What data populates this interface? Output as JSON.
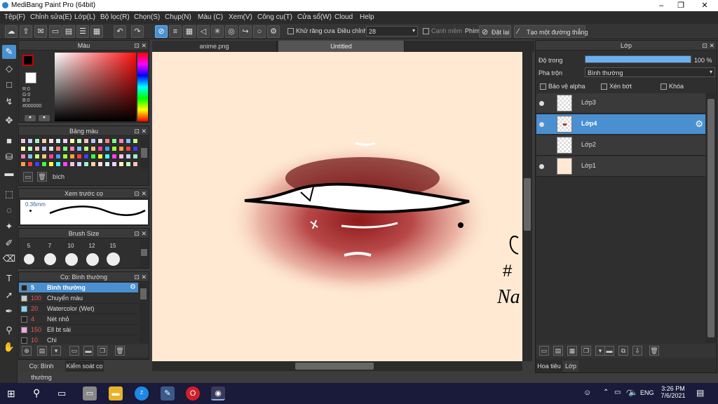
{
  "window": {
    "title": "MediBang Paint Pro (64bit)",
    "minimize": "–",
    "maximize": "❐",
    "close": "✕"
  },
  "menu": [
    "Tệp(F)",
    "Chỉnh sửa(E)",
    "Lớp(L)",
    "Bộ lọc(R)",
    "Chọn(S)",
    "Chụp(N)",
    "Màu (C)",
    "Xem(V)",
    "Công cụ(T)",
    "Cửa sổ(W)",
    "Cloud",
    "Help"
  ],
  "toolbar": {
    "antialias_label": "Khử răng cưa",
    "adjust_label": "Điều chỉnh",
    "adjust_value": "28",
    "edge_label": "Cạnh mềm",
    "key_label": "Phím",
    "reset_label": "Đặt lại",
    "straight_line_label": "Tạo một đường thẳng"
  },
  "color_panel": {
    "title": "Màu",
    "r": "R:0",
    "g": "G:0",
    "b": "B:0",
    "hex": "#000000"
  },
  "palette_panel": {
    "title": "Bảng màu",
    "name": "bích"
  },
  "brush_preview_panel": {
    "title": "Xem trước cọ",
    "size": "0.36mm"
  },
  "brush_size_panel": {
    "title": "Brush Size",
    "sizes": [
      "5",
      "7",
      "10",
      "12",
      "15"
    ]
  },
  "brush_panel": {
    "title": "Cọ: Bình thường",
    "brushes": [
      {
        "size": "5",
        "name": "Bình thường",
        "color": "#222222"
      },
      {
        "size": "100",
        "name": "Chuyển màu",
        "color": "#cccccc"
      },
      {
        "size": "20",
        "name": "Watercolor (Wet)",
        "color": "#7fd8f8"
      },
      {
        "size": "4",
        "name": "Nét nhỏ",
        "color": "#222222"
      },
      {
        "size": "150",
        "name": "Ell bt sài",
        "color": "#f7a6e0"
      },
      {
        "size": "10",
        "name": "Chì",
        "color": "#222222"
      }
    ],
    "bottom_tabs": [
      "Cọ: Bình thường",
      "Kiểm soát cọ"
    ]
  },
  "doc_tabs": [
    "anime.png",
    "Untitled"
  ],
  "canvas_text": {
    "line1": "#",
    "line2": "Na"
  },
  "layer_panel": {
    "title": "Lớp",
    "opacity_label": "Độ trong",
    "opacity_value": "100 %",
    "opacity_fraction": 1.0,
    "blend_label": "Pha trộn",
    "blend_value": "Bình thường",
    "protect_alpha": "Bảo vệ alpha",
    "clipping": "Xén bớt",
    "lock": "Khóa",
    "layers": [
      {
        "name": "Lớp3",
        "visible": true,
        "selected": false
      },
      {
        "name": "Lớp4",
        "visible": true,
        "selected": true
      },
      {
        "name": "Lớp2",
        "visible": false,
        "selected": false
      },
      {
        "name": "Lớp1",
        "visible": true,
        "selected": false
      }
    ],
    "bottom_tabs": [
      "Hoa tiêu",
      "Lớp"
    ]
  },
  "taskbar": {
    "lang": "ENG",
    "time": "3:26 PM",
    "date": "7/6/2021"
  }
}
